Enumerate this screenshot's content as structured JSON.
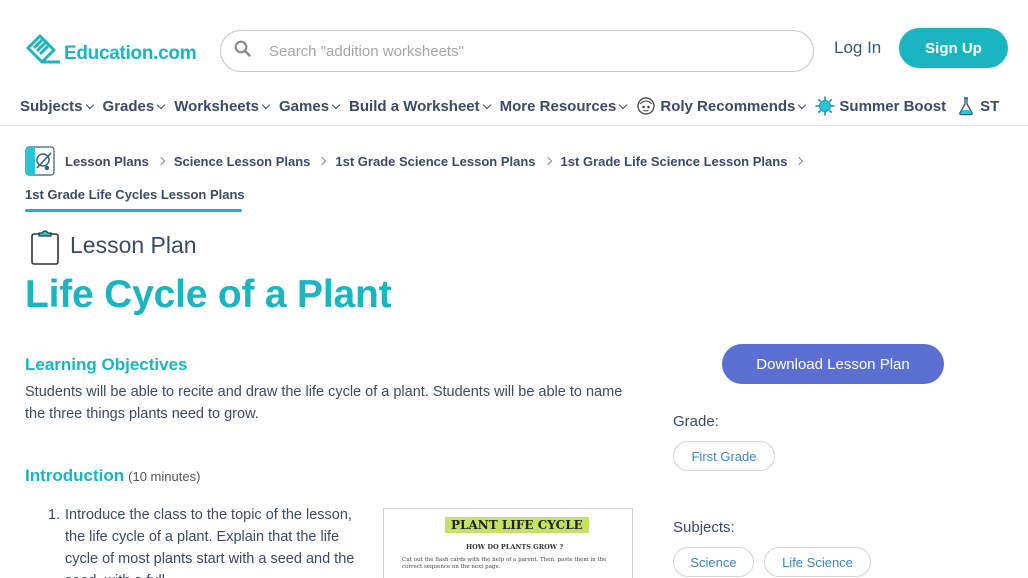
{
  "header": {
    "logo_text": "Education.com",
    "search_placeholder": "Search \"addition worksheets\"",
    "login_label": "Log In",
    "signup_label": "Sign Up"
  },
  "nav": {
    "items": [
      {
        "label": "Subjects",
        "icon": "",
        "chevron": true
      },
      {
        "label": "Grades",
        "icon": "",
        "chevron": true
      },
      {
        "label": "Worksheets",
        "icon": "",
        "chevron": true
      },
      {
        "label": "Games",
        "icon": "",
        "chevron": true
      },
      {
        "label": "Build a Worksheet",
        "icon": "",
        "chevron": true
      },
      {
        "label": "More Resources",
        "icon": "",
        "chevron": true
      },
      {
        "label": "Roly Recommends",
        "icon": "roly-icon",
        "chevron": true
      },
      {
        "label": "Summer Boost",
        "icon": "sun-icon",
        "chevron": false
      },
      {
        "label": "ST",
        "icon": "flask-icon",
        "chevron": false
      }
    ]
  },
  "breadcrumb": {
    "items": [
      "Lesson Plans",
      "Science Lesson Plans",
      "1st Grade Science Lesson Plans",
      "1st Grade Life Science Lesson Plans"
    ],
    "current": "1st Grade Life Cycles Lesson Plans"
  },
  "lesson": {
    "type_label": "Lesson Plan",
    "title": "Life Cycle of a Plant",
    "objectives_heading": "Learning Objectives",
    "objectives_text": "Students will be able to recite and draw the life cycle of a plant. Students will be able to name the three things plants need to grow.",
    "intro_heading": "Introduction",
    "intro_minutes": "(10 minutes)",
    "intro_step_number": "1.",
    "intro_step_text": "Introduce the class to the topic of the lesson, the life cycle of a plant. Explain that the life cycle of most plants start with a seed and the seed, with a full"
  },
  "worksheet_preview": {
    "heading": "PLANT LIFE CYCLE",
    "subheading": "HOW DO PLANTS GROW ?",
    "body": "Cut out the flash cards with the help of a parent. Then, paste them in the correct sequence on the next page."
  },
  "sidebar": {
    "download_label": "Download Lesson Plan",
    "grade_label": "Grade:",
    "grade_value": "First Grade",
    "subjects_label": "Subjects:",
    "subjects": [
      "Science",
      "Life Science"
    ]
  },
  "colors": {
    "brand_teal": "#1ab5c1",
    "download_blue": "#5a6fd0",
    "nav_text": "#3b4a66",
    "link_blue": "#3a85c8"
  }
}
